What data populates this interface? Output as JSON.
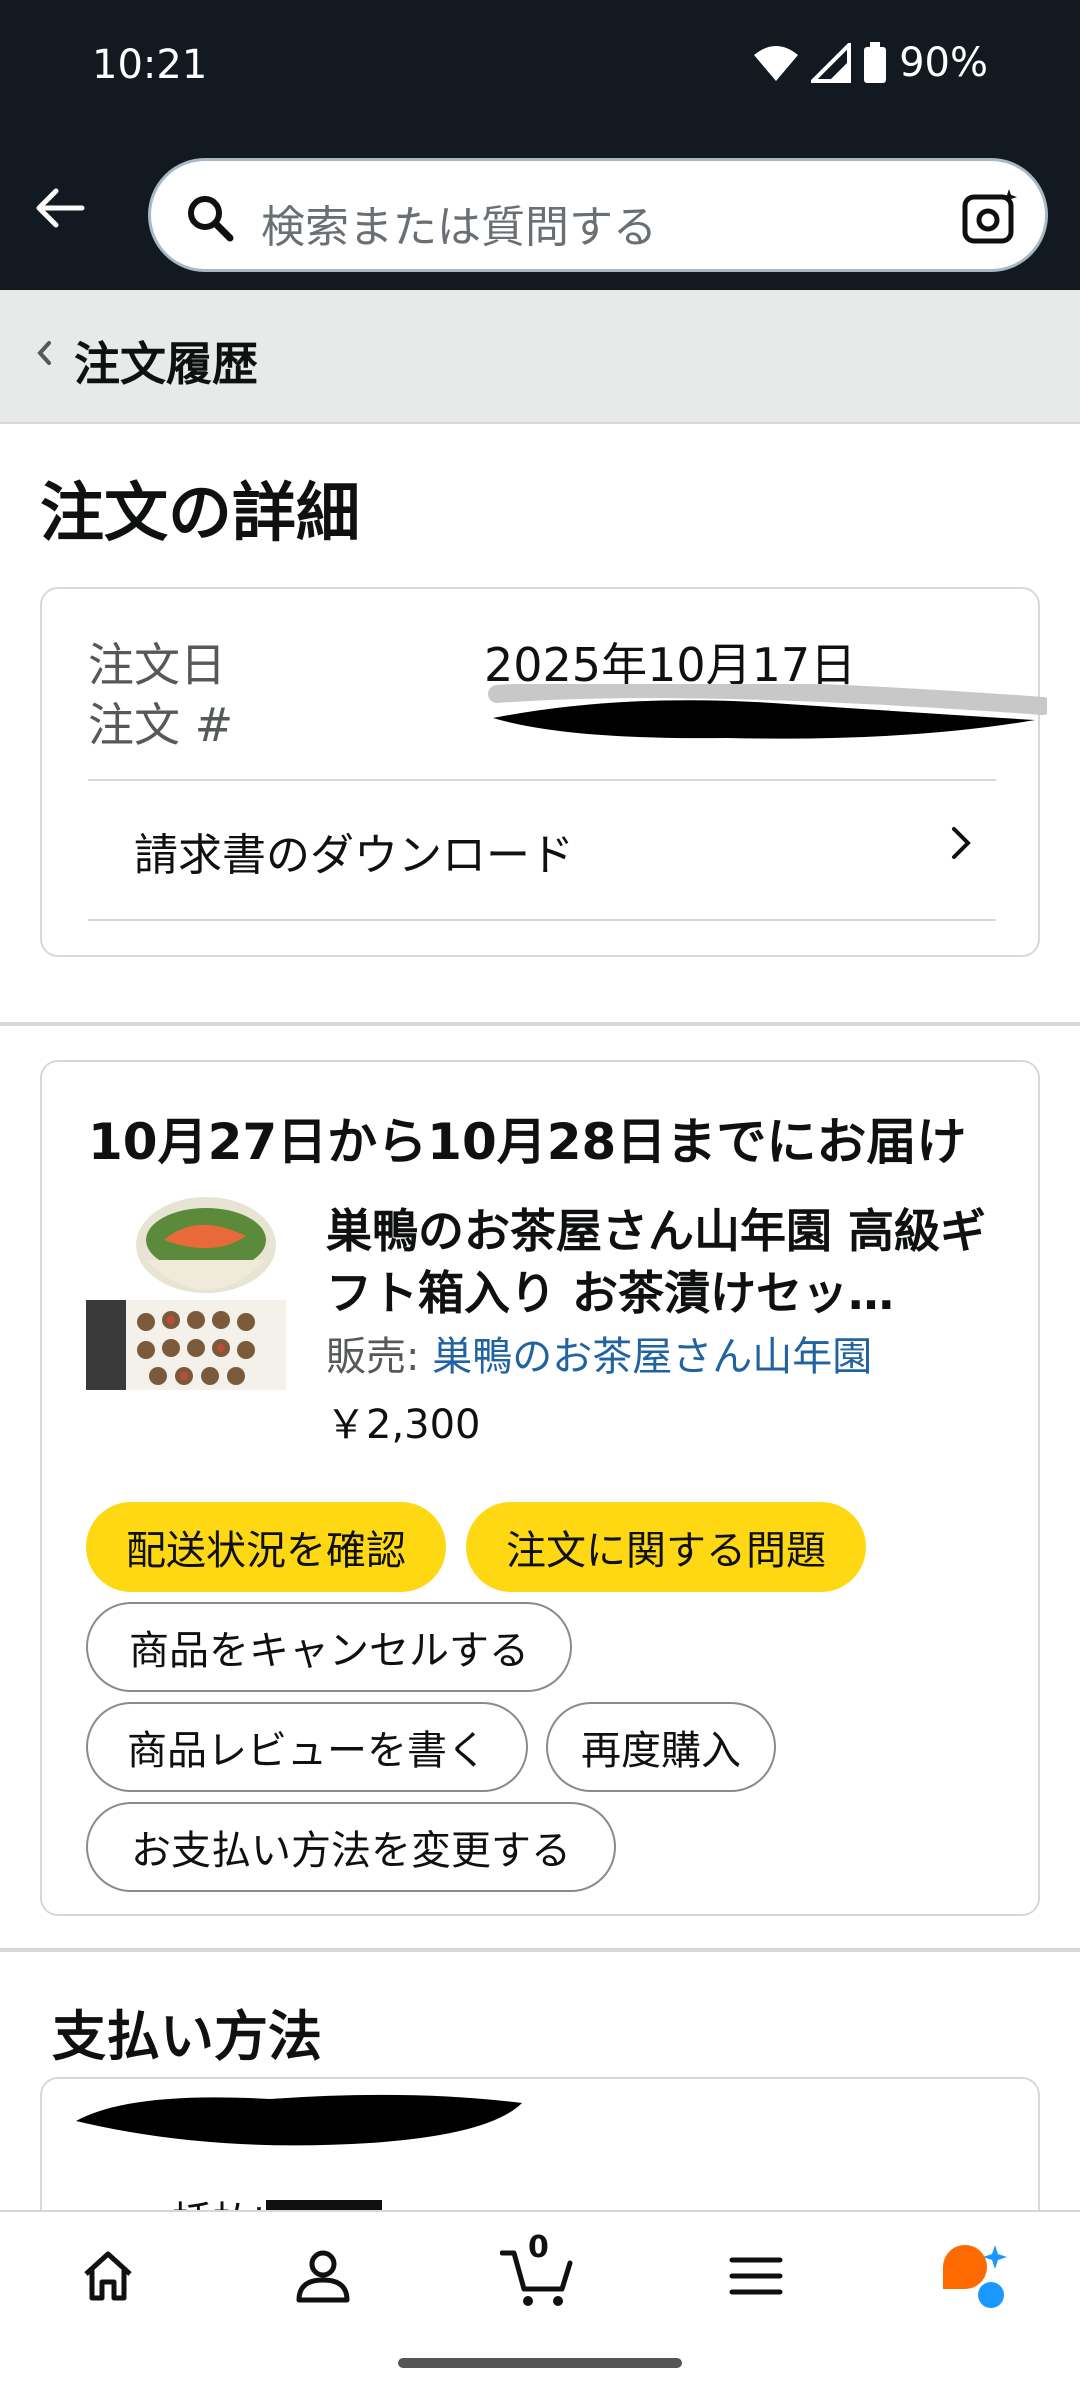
{
  "status_bar": {
    "time": "10:21",
    "battery": "90%"
  },
  "search": {
    "placeholder": "検索または質問する"
  },
  "breadcrumb": {
    "label": "注文履歴"
  },
  "page_title": "注文の詳細",
  "order_info": {
    "date_label": "注文日",
    "date_value": "2025年10月17日",
    "number_label": "注文 #",
    "invoice_label": "請求書のダウンロード"
  },
  "delivery": {
    "title": "10月27日から10月28日までにお届け",
    "product_title": "巣鴨のお茶屋さん山年園 高級ギフト箱入り お茶漬けセッ…",
    "seller_prefix": "販売: ",
    "seller_name": "巣鴨のお茶屋さん山年園",
    "price": "￥2,300",
    "buttons": {
      "track": "配送状況を確認",
      "problem": "注文に関する問題",
      "cancel": "商品をキャンセルする",
      "review": "商品レビューを書く",
      "rebuy": "再度購入",
      "change_payment": "お支払い方法を変更する"
    }
  },
  "payment": {
    "title": "支払い方法",
    "partial_text": "一括払い"
  },
  "bottom_nav": {
    "cart_count": "0"
  },
  "colors": {
    "header_bg": "#131921",
    "yellow_button": "#ffd814",
    "link": "#2162a1",
    "ai_orange": "#ff6a00",
    "ai_blue": "#1a98ff"
  }
}
